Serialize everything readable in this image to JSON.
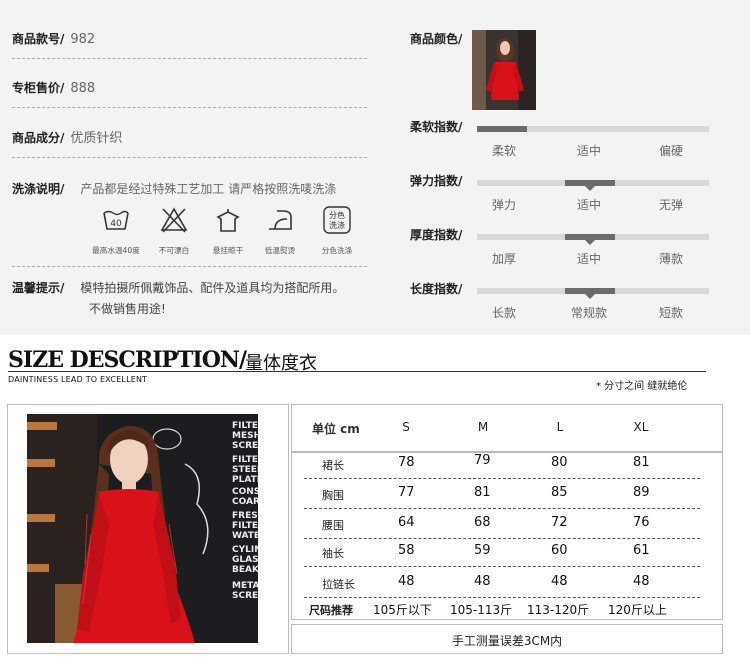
{
  "product": {
    "style_no": {
      "key": "商品款号/",
      "value": "982"
    },
    "price": {
      "key": "专柜售价/",
      "value": "888"
    },
    "material": {
      "key": "商品成分/",
      "value": "优质针织"
    },
    "washing": {
      "key": "洗涤说明/",
      "value": "产品都是经过特殊工艺加工 请严格按照洗唛洗涤"
    },
    "care_icons": [
      {
        "icon": "wash-40-icon",
        "label": "最高水温40度",
        "text": "40"
      },
      {
        "icon": "no-bleach-icon",
        "label": "不可漂白"
      },
      {
        "icon": "hang-dry-icon",
        "label": "悬挂晾干"
      },
      {
        "icon": "low-iron-icon",
        "label": "低温熨烫"
      },
      {
        "icon": "separate-wash-icon",
        "label": "分色洗涤",
        "text1": "分色",
        "text2": "洗涤"
      }
    ],
    "notice": {
      "key": "温馨提示/",
      "line1": "模特拍摄所佩戴饰品、配件及道具均为搭配所用。",
      "line2": "不做销售用途!"
    },
    "color": {
      "key": "商品颜色/"
    }
  },
  "indices": [
    {
      "key": "柔软指数/",
      "options": [
        "柔软",
        "适中",
        "偏硬"
      ],
      "level": 0
    },
    {
      "key": "弹力指数/",
      "options": [
        "弹力",
        "适中",
        "无弹"
      ],
      "level": 1
    },
    {
      "key": "厚度指数/",
      "options": [
        "加厚",
        "适中",
        "薄款"
      ],
      "level": 1
    },
    {
      "key": "长度指数/",
      "options": [
        "长款",
        "常规款",
        "短款"
      ],
      "level": 1
    }
  ],
  "size_section": {
    "title_en": "SIZE DESCRIPTION/",
    "title_cn": "量体度衣",
    "subtitle": "DAINTINESS LEAD TO EXCELLENT",
    "note": "* 分寸之间 缝就绝伦"
  },
  "size_table": {
    "unit": "单位 cm",
    "sizes": [
      "S",
      "M",
      "L",
      "XL"
    ],
    "rows": [
      {
        "label": "裙长",
        "values": [
          "78",
          "79",
          "80",
          "81"
        ]
      },
      {
        "label": "胸围",
        "values": [
          "77",
          "81",
          "85",
          "89"
        ]
      },
      {
        "label": "腰围",
        "values": [
          "64",
          "68",
          "72",
          "76"
        ]
      },
      {
        "label": "袖长",
        "values": [
          "58",
          "59",
          "60",
          "61"
        ]
      },
      {
        "label": "拉链长",
        "values": [
          "48",
          "48",
          "48",
          "48"
        ]
      }
    ],
    "recommend": {
      "label": "尺码推荐",
      "values": [
        "105斤以下",
        "105-113斤",
        "113-120斤",
        "120斤以上"
      ]
    },
    "footer": "手工测量误差3CM内"
  },
  "photo_board_text": [
    "FILTE",
    "MESH",
    "SCREE",
    "FILTE",
    "STEEL",
    "PLATE",
    "CONSIS",
    "COARSE G",
    "FRESH",
    "FILTER",
    "WATE",
    "CYLIND",
    "GLASS",
    "BEAKER",
    "METALH",
    "SCREE"
  ],
  "colors": {
    "dress": "#d8111a",
    "background": "#f3f3f3",
    "bar": "#d9d9d9",
    "marker": "#6b6b6b"
  }
}
